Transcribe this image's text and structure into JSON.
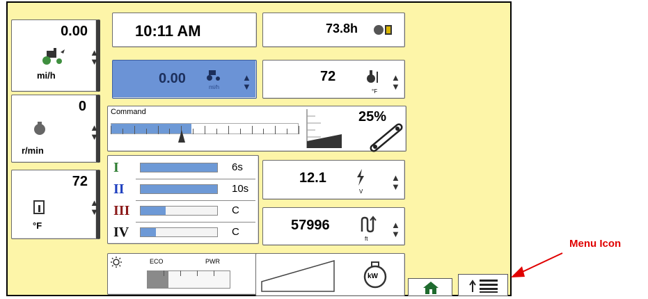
{
  "speed": {
    "value": "0.00",
    "unit": "mi/h",
    "icon": "tractor-icon"
  },
  "clock": {
    "time": "10:11 AM"
  },
  "engine_hours": {
    "value": "73.8h",
    "icon": "engine-hours-icon"
  },
  "set_speed": {
    "value": "0.00",
    "unit": "mi/h",
    "icon": "tractor-icon"
  },
  "coolant_temp": {
    "value": "72",
    "unit": "°F",
    "icon": "coolant-temperature-icon"
  },
  "engine_rpm": {
    "value": "0",
    "unit": "r/min",
    "icon": "engine-icon"
  },
  "command": {
    "label": "Command",
    "fill_fraction": 0.43
  },
  "throttle": {
    "value": "25%",
    "icon": "throttle-lever-icon"
  },
  "oil_temp": {
    "value": "72",
    "unit": "°F",
    "icon": "oil-temperature-icon"
  },
  "gears": [
    {
      "numeral": "I",
      "color": "#2e7d32",
      "fill_fraction": 1.0,
      "value": "6s"
    },
    {
      "numeral": "II",
      "color": "#1e3fbf",
      "fill_fraction": 1.0,
      "value": "10s"
    },
    {
      "numeral": "III",
      "color": "#8b1a1a",
      "fill_fraction": 0.33,
      "value": "C"
    },
    {
      "numeral": "IV",
      "color": "#111111",
      "fill_fraction": 0.2,
      "value": "C"
    }
  ],
  "voltage": {
    "value": "12.1",
    "unit": "V",
    "icon": "lightning-icon"
  },
  "distance": {
    "value": "57996",
    "unit": "ft",
    "icon": "distance-icon"
  },
  "mode": {
    "eco_label": "ECO",
    "pwr_label": "PWR",
    "fill_fraction": 0.25,
    "icon": "sun-icon"
  },
  "power": {
    "unit": "kW",
    "icon": "engine-power-icon"
  },
  "softkeys": {
    "home": "home-icon",
    "menu": "menu-icon"
  },
  "annotation": {
    "label": "Menu Icon",
    "color": "#e00000"
  }
}
